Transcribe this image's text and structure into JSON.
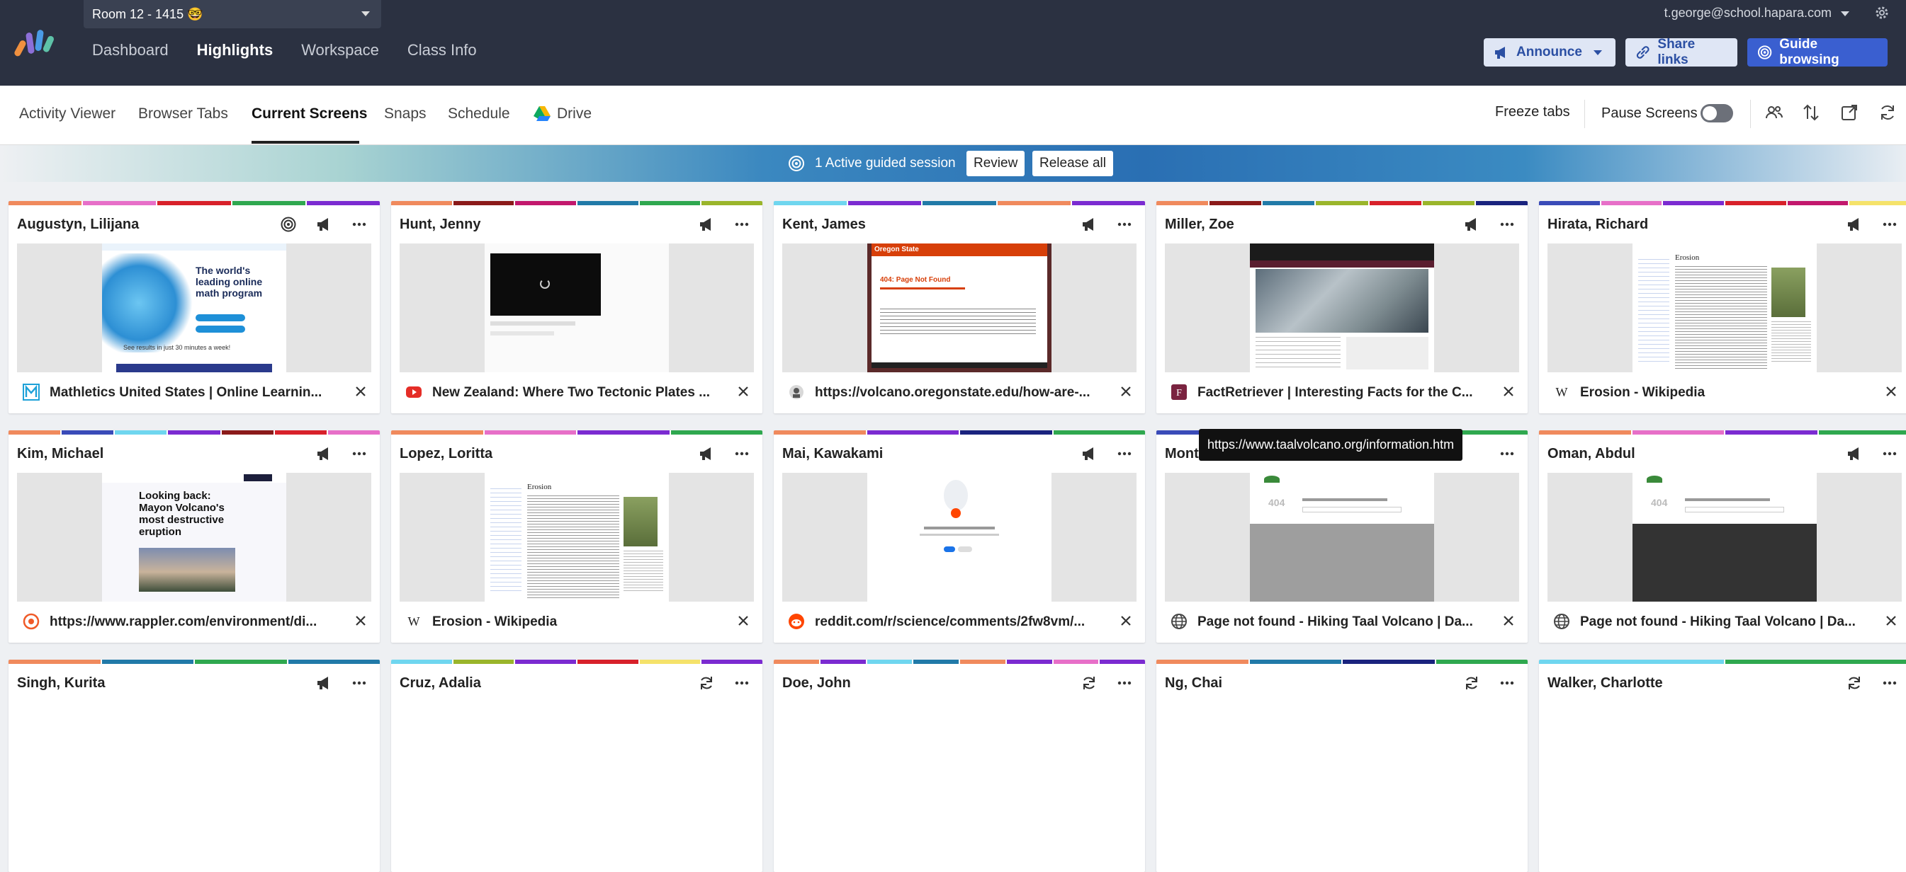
{
  "header": {
    "room": "Room 12 - 1415 🤓",
    "nav": [
      "Dashboard",
      "Highlights",
      "Workspace",
      "Class Info"
    ],
    "active_nav": 1,
    "user": "t.george@school.hapara.com",
    "buttons": {
      "announce": "Announce",
      "share": "Share links",
      "guide": "Guide browsing"
    }
  },
  "subnav": {
    "tabs": [
      "Activity Viewer",
      "Browser Tabs",
      "Current Screens",
      "Snaps",
      "Schedule",
      "Drive"
    ],
    "active": 2,
    "freeze": "Freeze tabs",
    "pause": "Pause Screens"
  },
  "banner": {
    "text": "1 Active guided session",
    "review": "Review",
    "release": "Release all"
  },
  "tooltip": "https://www.taalvolcano.org/information.htm",
  "colors": {
    "header_bg": "#2b3141",
    "accent": "#3a5fd0"
  },
  "students": [
    {
      "name": "Augustyn, Lilijana",
      "tab_title": "Mathletics United States | Online Learnin...",
      "icons": [
        "target-icon",
        "megaphone-icon",
        "more-icon"
      ],
      "favicon": "mathletics-favicon-icon",
      "stripe": [
        "#f08a5d",
        "#e76fc8",
        "#d8212a",
        "#2fa84f",
        "#7b2bd1"
      ],
      "shot": "math",
      "shot_text": {
        "heading": "The world's leading online math program",
        "foot": "See results in just 30 minutes a week!"
      }
    },
    {
      "name": "Hunt, Jenny",
      "tab_title": "New Zealand: Where Two Tectonic Plates ...",
      "icons": [
        "megaphone-icon",
        "more-icon"
      ],
      "favicon": "youtube-favicon-icon",
      "stripe": [
        "#f08a5d",
        "#8b1a1a",
        "#c2186d",
        "#217aa8",
        "#2fa84f",
        "#9ab52b"
      ],
      "shot": "video",
      "shot_text": {}
    },
    {
      "name": "Kent, James",
      "tab_title": "https://volcano.oregonstate.edu/how-are-...",
      "icons": [
        "megaphone-icon",
        "more-icon"
      ],
      "favicon": "oregon-favicon-icon",
      "stripe": [
        "#6fd6ef",
        "#7b2bd1",
        "#217aa8",
        "#f08a5d",
        "#7b2bd1"
      ],
      "shot": "oregon",
      "shot_text": {
        "title": "Oregon State",
        "heading": "404: Page Not Found"
      }
    },
    {
      "name": "Miller, Zoe",
      "tab_title": "FactRetriever | Interesting Facts for the C...",
      "icons": [
        "megaphone-icon",
        "more-icon"
      ],
      "favicon": "factretriever-favicon-icon",
      "stripe": [
        "#f08a5d",
        "#8b1a1a",
        "#217aa8",
        "#9ab52b",
        "#d8212a",
        "#9ab52b",
        "#1a237e"
      ],
      "shot": "fact",
      "shot_text": {}
    },
    {
      "name": "Hirata, Richard",
      "tab_title": "Erosion - Wikipedia",
      "icons": [
        "megaphone-icon",
        "more-icon"
      ],
      "favicon": "wikipedia-favicon-icon",
      "stripe": [
        "#3a4bb8",
        "#e76fc8",
        "#7b2bd1",
        "#d8212a",
        "#c2186d",
        "#f5e26a"
      ],
      "shot": "wiki",
      "shot_text": {
        "heading": "Erosion"
      }
    },
    {
      "name": "Kim, Michael",
      "tab_title": "https://www.rappler.com/environment/di...",
      "icons": [
        "megaphone-icon",
        "more-icon"
      ],
      "favicon": "rappler-favicon-icon",
      "stripe": [
        "#f08a5d",
        "#3a4bb8",
        "#6fd6ef",
        "#7b2bd1",
        "#8b1a1a",
        "#d8212a",
        "#e76fc8"
      ],
      "shot": "rappler",
      "shot_text": {
        "heading": "Looking back: Mayon Volcano's most destructive eruption"
      }
    },
    {
      "name": "Lopez, Loritta",
      "tab_title": "Erosion - Wikipedia",
      "icons": [
        "megaphone-icon",
        "more-icon"
      ],
      "favicon": "wikipedia-favicon-icon",
      "stripe": [
        "#f08a5d",
        "#e76fc8",
        "#7b2bd1",
        "#2fa84f"
      ],
      "shot": "wiki",
      "shot_text": {
        "heading": "Erosion"
      }
    },
    {
      "name": "Mai, Kawakami",
      "tab_title": "reddit.com/r/science/comments/2fw8vm/...",
      "icons": [
        "megaphone-icon",
        "more-icon"
      ],
      "favicon": "reddit-favicon-icon",
      "stripe": [
        "#f08a5d",
        "#7b2bd1",
        "#1a237e",
        "#2fa84f"
      ],
      "shot": "reddit",
      "shot_text": {}
    },
    {
      "name": "Mont",
      "tab_title": "Page not found - Hiking Taal Volcano | Da...",
      "icons": [
        "more-icon"
      ],
      "favicon": "globe-favicon-icon",
      "stripe": [
        "#3a4bb8",
        "#2fa84f"
      ],
      "shot": "taal",
      "shot_text": {
        "code": "404"
      }
    },
    {
      "name": "Oman, Abdul",
      "tab_title": "Page not found - Hiking Taal Volcano | Da...",
      "icons": [
        "megaphone-icon",
        "more-icon"
      ],
      "favicon": "globe-favicon-icon",
      "stripe": [
        "#f08a5d",
        "#e76fc8",
        "#7b2bd1",
        "#2fa84f"
      ],
      "shot": "taal-dark",
      "shot_text": {
        "code": "404"
      }
    },
    {
      "name": "Singh, Kurita",
      "tab_title": "",
      "icons": [
        "megaphone-icon",
        "more-icon"
      ],
      "favicon": "",
      "stripe": [
        "#f08a5d",
        "#217aa8",
        "#2fa84f",
        "#217aa8"
      ],
      "shot": "none",
      "shot_text": {}
    },
    {
      "name": "Cruz, Adalia",
      "tab_title": "",
      "icons": [
        "refresh-icon",
        "more-icon"
      ],
      "favicon": "",
      "stripe": [
        "#6fd6ef",
        "#9ab52b",
        "#7b2bd1",
        "#d8212a",
        "#f5e26a",
        "#7b2bd1"
      ],
      "shot": "none",
      "shot_text": {}
    },
    {
      "name": "Doe, John",
      "tab_title": "",
      "icons": [
        "refresh-icon",
        "more-icon"
      ],
      "favicon": "",
      "stripe": [
        "#f08a5d",
        "#7b2bd1",
        "#6fd6ef",
        "#217aa8",
        "#f08a5d",
        "#7b2bd1",
        "#e76fc8",
        "#7b2bd1"
      ],
      "shot": "none",
      "shot_text": {}
    },
    {
      "name": "Ng, Chai",
      "tab_title": "",
      "icons": [
        "refresh-icon",
        "more-icon"
      ],
      "favicon": "",
      "stripe": [
        "#f08a5d",
        "#217aa8",
        "#1a237e",
        "#2fa84f"
      ],
      "shot": "none",
      "shot_text": {}
    },
    {
      "name": "Walker, Charlotte",
      "tab_title": "",
      "icons": [
        "refresh-icon",
        "more-icon"
      ],
      "favicon": "",
      "stripe": [
        "#6fd6ef",
        "#2fa84f"
      ],
      "shot": "none",
      "shot_text": {}
    }
  ]
}
